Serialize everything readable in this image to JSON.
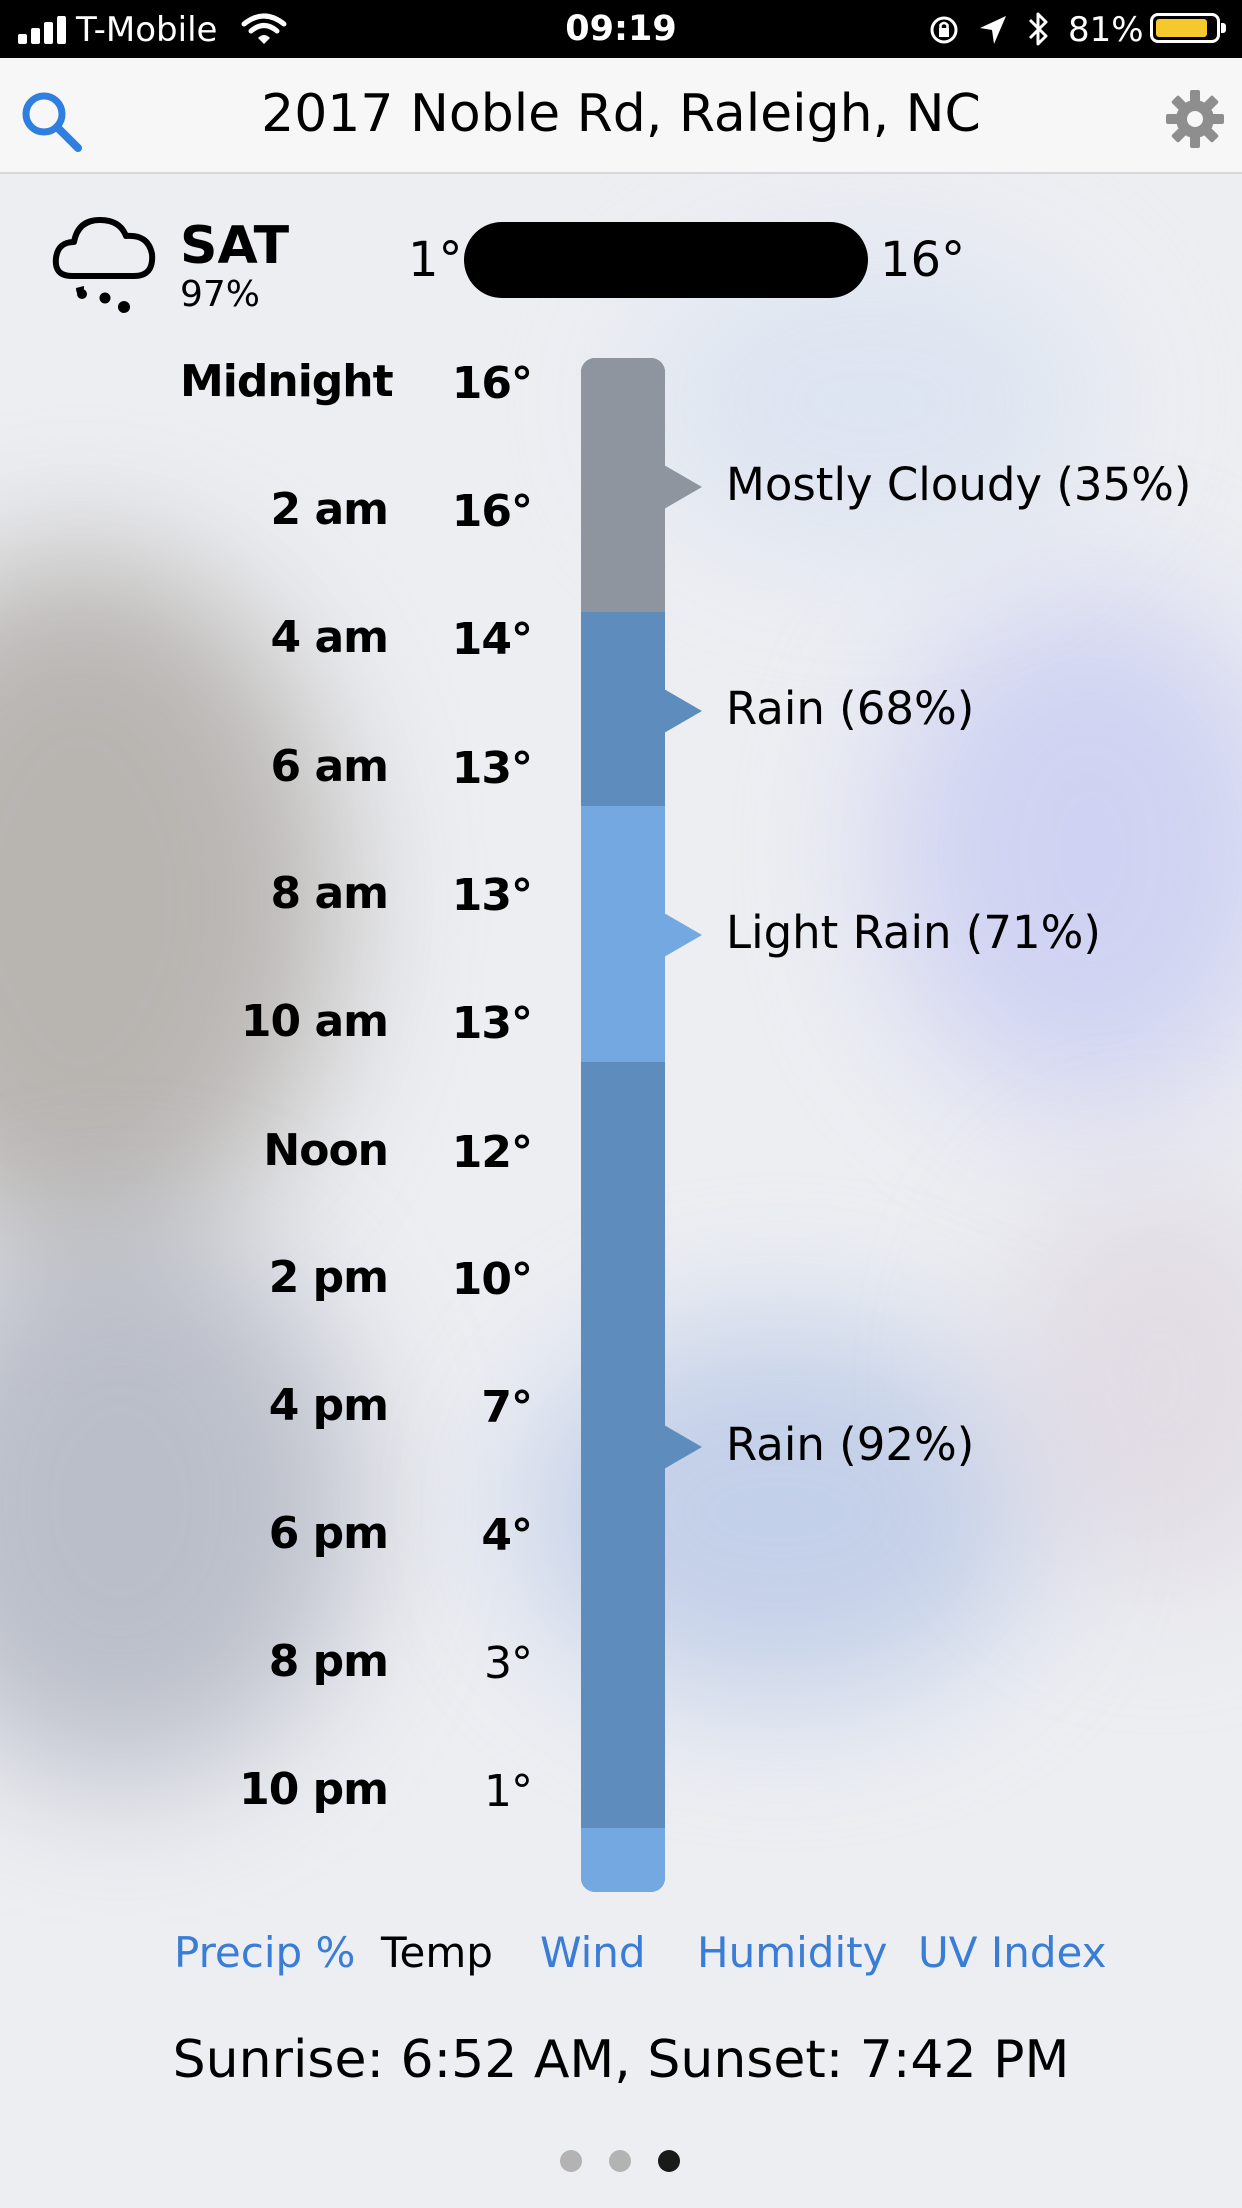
{
  "status_bar": {
    "carrier": "T-Mobile",
    "time": "09:19",
    "battery": "81%"
  },
  "nav": {
    "title": "2017 Noble Rd, Raleigh, NC",
    "search_icon": "search-icon",
    "settings_icon": "gear-icon"
  },
  "day": {
    "icon": "rain-cloud-icon",
    "name": "SAT",
    "precip": "97%",
    "low": "1°",
    "high": "16°"
  },
  "hours": [
    {
      "label": "Midnight",
      "temp": "16°",
      "weight": "bold"
    },
    {
      "label": "2 am",
      "temp": "16°",
      "weight": "bold"
    },
    {
      "label": "4 am",
      "temp": "14°",
      "weight": "bold"
    },
    {
      "label": "6 am",
      "temp": "13°",
      "weight": "bold"
    },
    {
      "label": "8 am",
      "temp": "13°",
      "weight": "bold"
    },
    {
      "label": "10 am",
      "temp": "13°",
      "weight": "bold"
    },
    {
      "label": "Noon",
      "temp": "12°",
      "weight": "bold"
    },
    {
      "label": "2 pm",
      "temp": "10°",
      "weight": "bold"
    },
    {
      "label": "4 pm",
      "temp": "7°",
      "weight": "bold"
    },
    {
      "label": "6 pm",
      "temp": "4°",
      "weight": "bold"
    },
    {
      "label": "8 pm",
      "temp": "3°",
      "weight": "normal"
    },
    {
      "label": "10 pm",
      "temp": "1°",
      "weight": "normal"
    }
  ],
  "conditions": [
    {
      "label": "Mostly Cloudy (35%)",
      "color": "#8e959f"
    },
    {
      "label": "Rain (68%)",
      "color": "#5e8dbd"
    },
    {
      "label": "Light Rain (71%)",
      "color": "#73a8e0"
    },
    {
      "label": "Rain (92%)",
      "color": "#5e8dbd"
    }
  ],
  "colors": {
    "cloudy": "#8e959f",
    "rain": "#5e8dbd",
    "light_rain": "#73a8e0",
    "tab_link": "#3a7dd6",
    "nav_icon_blue": "#2f7fe0",
    "nav_icon_gray": "#8e8e8e"
  },
  "tabs": [
    {
      "label": "Precip %",
      "active": false
    },
    {
      "label": "Temp",
      "active": true
    },
    {
      "label": "Wind",
      "active": false
    },
    {
      "label": "Humidity",
      "active": false
    },
    {
      "label": "UV Index",
      "active": false
    }
  ],
  "sun_text": "Sunrise: 6:52 AM, Sunset: 7:42 PM",
  "pager": {
    "count": 3,
    "active": 3
  }
}
